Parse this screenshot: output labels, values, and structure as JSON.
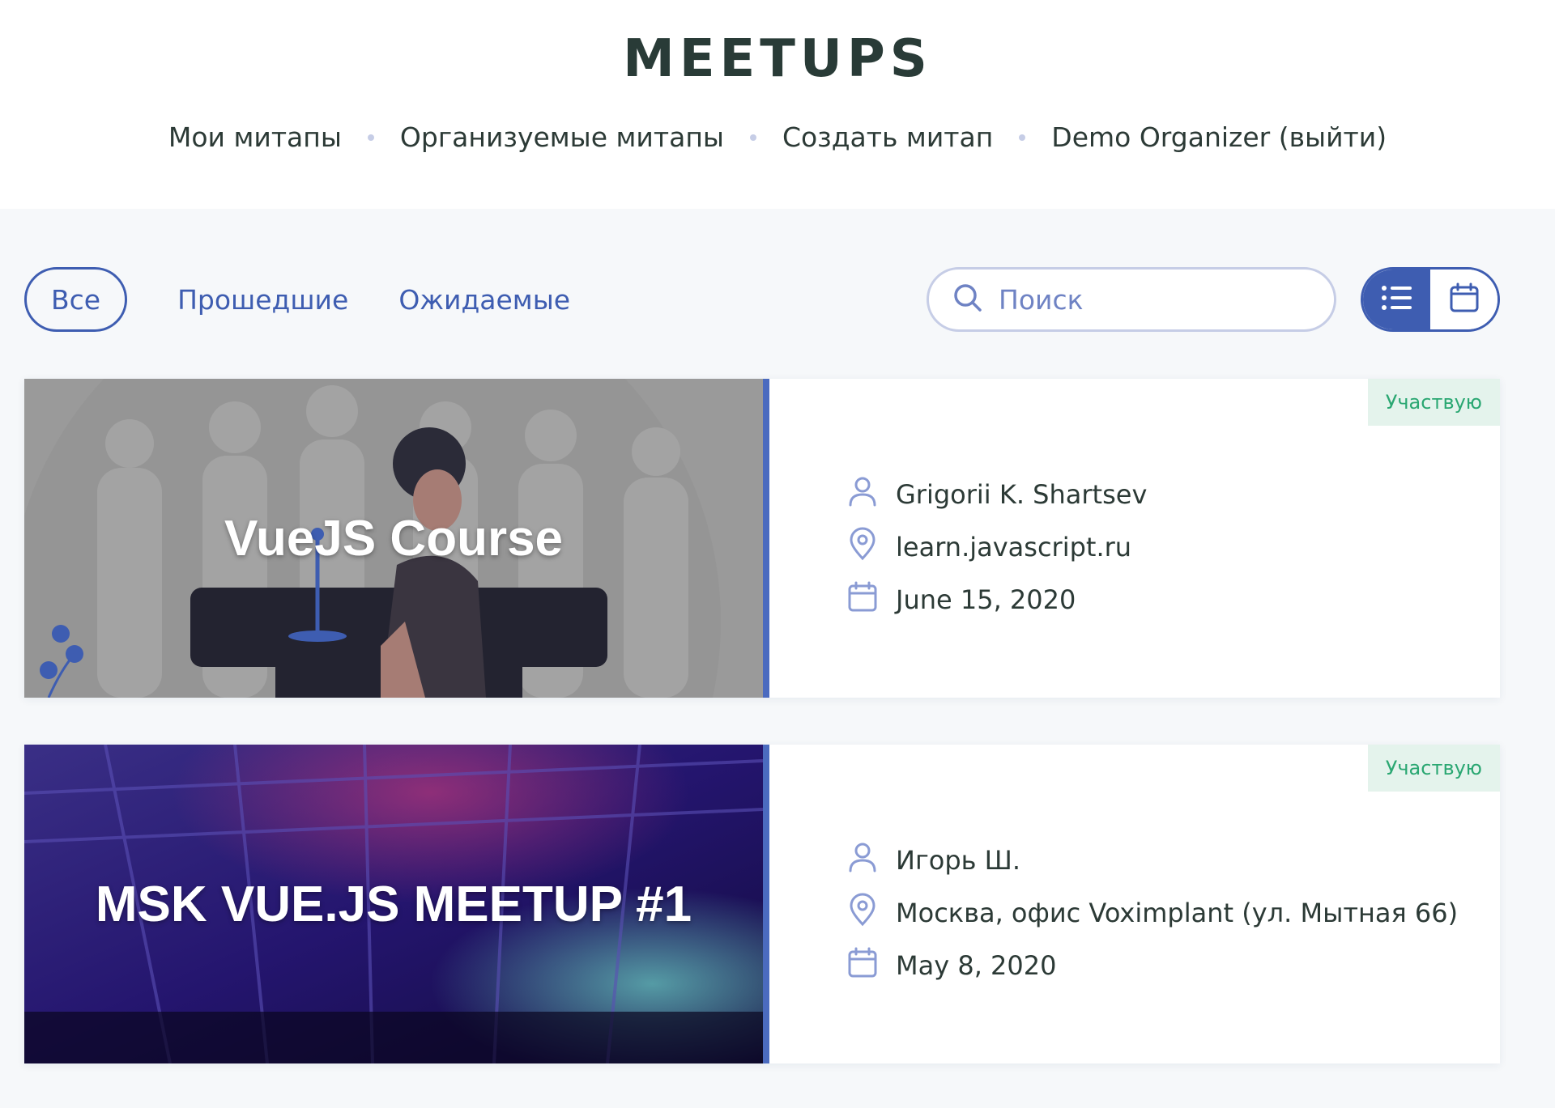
{
  "header": {
    "logo": "MEETUPS",
    "nav": [
      {
        "label": "Мои митапы"
      },
      {
        "label": "Организуемые митапы"
      },
      {
        "label": "Создать митап"
      },
      {
        "label": "Demo Organizer (выйти)"
      }
    ]
  },
  "filters": [
    {
      "label": "Все",
      "active": true
    },
    {
      "label": "Прошедшие",
      "active": false
    },
    {
      "label": "Ожидаемые",
      "active": false
    }
  ],
  "search": {
    "placeholder": "Поиск",
    "value": ""
  },
  "view_toggle": {
    "selected": "list",
    "options": [
      "list-icon",
      "calendar-icon"
    ]
  },
  "colors": {
    "accent": "#3e5db1",
    "badge_bg": "#e4f3ec",
    "badge_text": "#2aa772",
    "divider": "#4b6bbf"
  },
  "meetups": [
    {
      "title": "VueJS Course",
      "badge": "Участвую",
      "organizer": "Grigorii K. Shartsev",
      "place": "learn.javascript.ru",
      "date": "June 15, 2020",
      "cover_style": "illustration"
    },
    {
      "title": "MSK VUE.JS MEETUP #1",
      "badge": "Участвую",
      "organizer": "Игорь Ш.",
      "place": "Москва, офис Voximplant (ул. Мытная 66)",
      "date": "May 8, 2020",
      "cover_style": "photo-venue"
    }
  ]
}
